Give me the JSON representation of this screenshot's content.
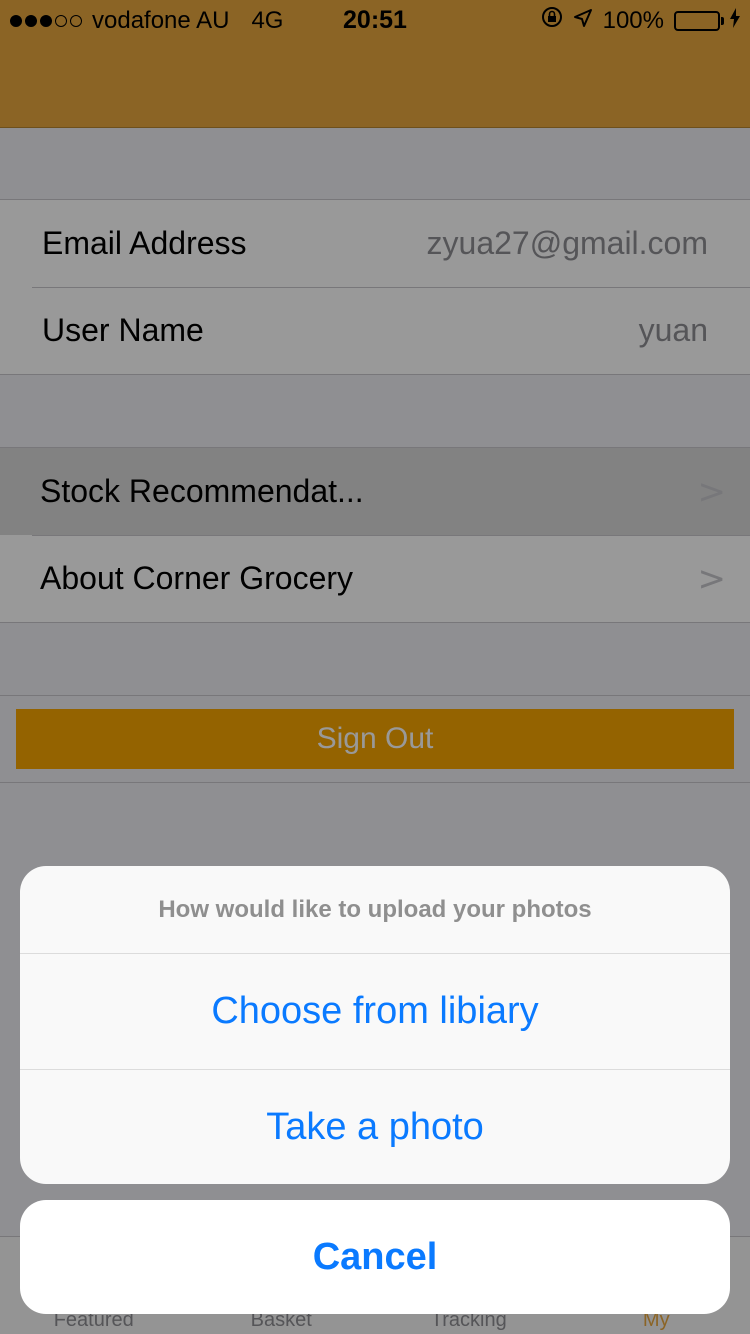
{
  "status_bar": {
    "signal_dots_filled": 3,
    "signal_dots_total": 5,
    "carrier": "vodafone AU",
    "network": "4G",
    "time": "20:51",
    "battery_percent": "100%"
  },
  "profile": {
    "email_label": "Email Address",
    "email_value": "zyua27@gmail.com",
    "username_label": "User Name",
    "username_value": "yuan"
  },
  "menu": {
    "items": [
      {
        "label": "Stock Recommendat..."
      },
      {
        "label": "About Corner Grocery"
      }
    ],
    "chevron": ">"
  },
  "sign_out_label": "Sign Out",
  "tab_bar": {
    "tabs": [
      {
        "label": "Featured"
      },
      {
        "label": "Basket"
      },
      {
        "label": "Tracking"
      },
      {
        "label": "My"
      }
    ]
  },
  "action_sheet": {
    "title": "How would like to upload your photos",
    "options": [
      {
        "label": "Choose from libiary"
      },
      {
        "label": "Take a photo"
      }
    ],
    "cancel_label": "Cancel"
  },
  "colors": {
    "brand": "#e8a73f",
    "sign_out": "#f7a500",
    "action_blue": "#0a7aff"
  }
}
